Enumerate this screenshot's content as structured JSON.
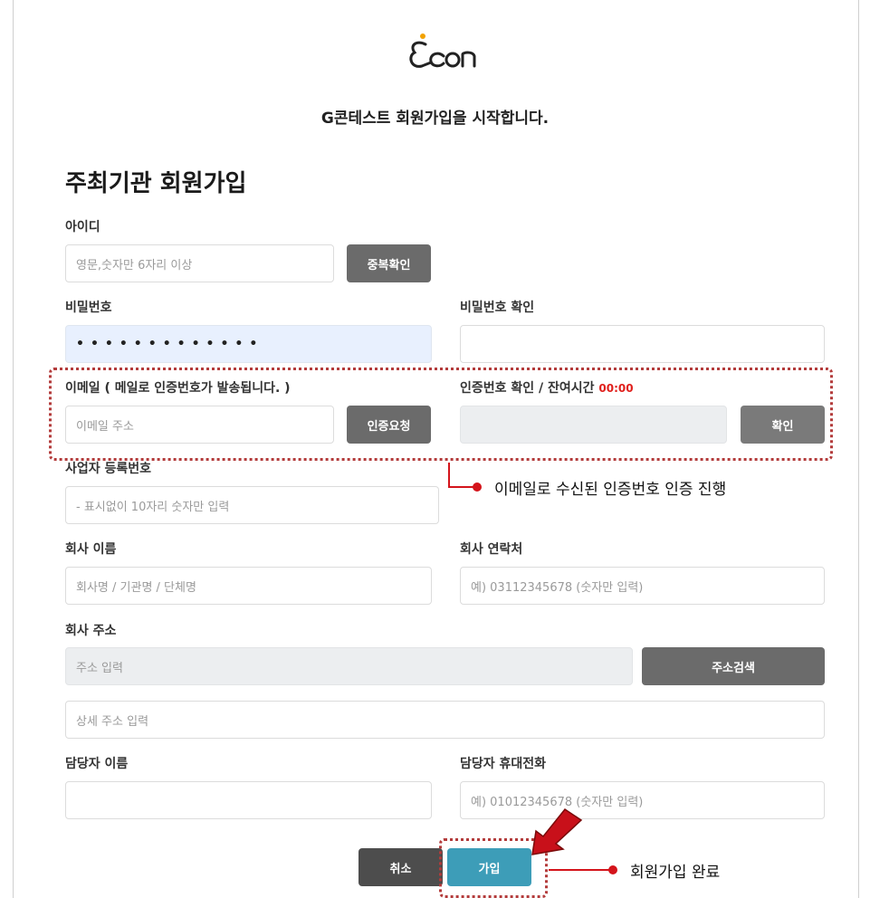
{
  "header": {
    "logo_text": "Econ",
    "tagline": "G콘테스트 회원가입을 시작합니다."
  },
  "form": {
    "title": "주최기관 회원가입",
    "id": {
      "label": "아이디",
      "placeholder": "영문,숫자만 6자리 이상",
      "check_button": "중복확인"
    },
    "password": {
      "label": "비밀번호",
      "masked_value": "•••••••••••••"
    },
    "password_confirm": {
      "label": "비밀번호 확인",
      "value": ""
    },
    "email": {
      "label": "이메일 ( 메일로 인증번호가 발송됩니다. )",
      "placeholder": "이메일 주소",
      "request_button": "인증요청"
    },
    "verify": {
      "label": "인증번호 확인 / 잔여시간 ",
      "timer": "00:00",
      "value": "",
      "confirm_button": "확인"
    },
    "business_number": {
      "label": "사업자 등록번호",
      "placeholder": "- 표시없이 10자리 숫자만 입력"
    },
    "company_name": {
      "label": "회사 이름",
      "placeholder": "회사명 / 기관명 / 단체명"
    },
    "company_phone": {
      "label": "회사 연락처",
      "placeholder": "예) 03112345678 (숫자만 입력)"
    },
    "company_address": {
      "label": "회사 주소",
      "placeholder": "주소 입력",
      "search_button": "주소검색",
      "detail_placeholder": "상세 주소 입력"
    },
    "manager_name": {
      "label": "담당자 이름",
      "value": ""
    },
    "manager_phone": {
      "label": "담당자 휴대전화",
      "placeholder": "예) 01012345678 (숫자만 입력)"
    },
    "cancel_button": "취소",
    "submit_button": "가입"
  },
  "annotations": {
    "email_callout": "이메일로 수신된 인증번호  인증 진행",
    "submit_callout": "회원가입 완료",
    "highlight_color": "#b33b3b",
    "callout_color": "#d4141b"
  },
  "colors": {
    "accent_blue": "#3d9db8",
    "button_gray": "#6b6b6b",
    "timer_red": "#e0201c",
    "logo_orange": "#f2a200"
  }
}
